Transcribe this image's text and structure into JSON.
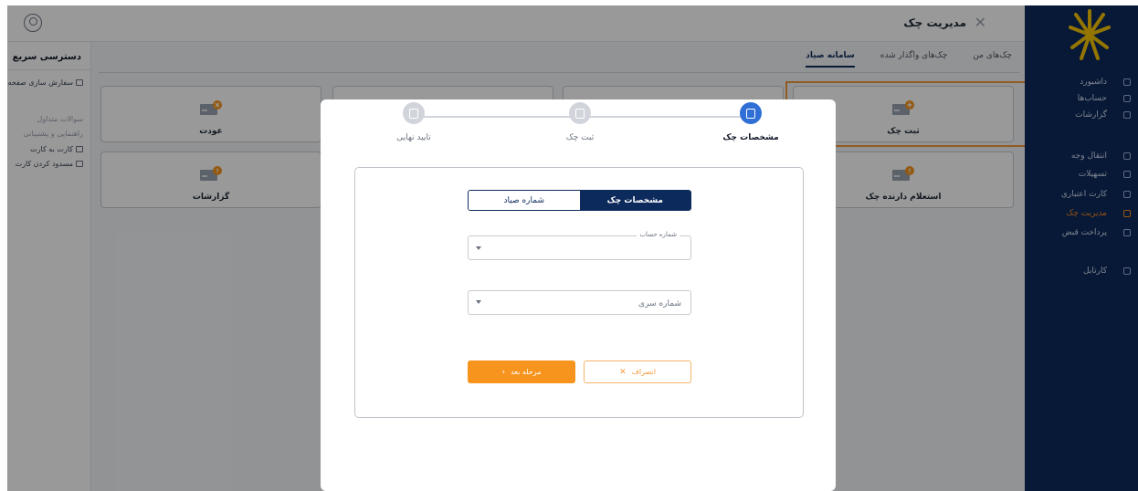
{
  "header": {
    "title": "مدیریت چک",
    "close_icon": "close-icon",
    "user_icon": "user-icon"
  },
  "quick_access": {
    "title": "دسترسی سریع",
    "items": [
      {
        "label": "سفارش سازی صفحه",
        "icon": "settings-icon",
        "muted": false
      },
      {
        "label": "سوالات متداول",
        "muted": true
      },
      {
        "label": "راهنمایی و پشتیبانی",
        "muted": true
      },
      {
        "label": "کارت به کارت",
        "icon": "card-icon",
        "muted": false
      },
      {
        "label": "مسدود کردن کارت",
        "icon": "block-card-icon",
        "muted": false
      }
    ]
  },
  "nav": {
    "items": [
      {
        "label": "داشبورد",
        "icon": "dashboard-icon"
      },
      {
        "label": "حساب‌ها",
        "icon": "accounts-icon"
      },
      {
        "label": "گزارشات",
        "icon": "reports-icon"
      },
      {
        "label": "انتقال وجه",
        "icon": "transfer-icon"
      },
      {
        "label": "تسهیلات",
        "icon": "loan-icon"
      },
      {
        "label": "کارت اعتباری",
        "icon": "credit-card-icon"
      },
      {
        "label": "مدیریت چک",
        "icon": "cheque-icon",
        "active": true
      },
      {
        "label": "پرداخت قبض",
        "icon": "bill-icon"
      },
      {
        "label": "کارتابل",
        "icon": "cartable-icon"
      }
    ],
    "active_color": "#ff8c1a"
  },
  "tabs": [
    {
      "label": "چک‌های من",
      "active": false
    },
    {
      "label": "چک‌های واگذار شده",
      "active": false
    },
    {
      "label": "سامانه صیاد",
      "active": true
    }
  ],
  "cards": {
    "register": "ثبت چک",
    "return": "عودت",
    "holder_inquiry": "استعلام دارنده چک",
    "reports": "گزارشات"
  },
  "modal": {
    "steps": [
      {
        "label": "مشخصات چک",
        "active": true
      },
      {
        "label": "ثبت چک",
        "active": false
      },
      {
        "label": "تایید نهایی",
        "active": false
      }
    ],
    "segment": {
      "active": "مشخصات چک",
      "inactive": "شماره صیاد"
    },
    "account_field": {
      "label": "شماره حساب",
      "value": ""
    },
    "serial_field": {
      "placeholder": "شماره سری",
      "value": ""
    },
    "buttons": {
      "next": "مرحله بعد",
      "cancel": "انصراف"
    }
  },
  "colors": {
    "primary": "#0d2a5c",
    "accent": "#f7941d",
    "step_active": "#2f6fd6",
    "highlight": "#f29a3b"
  }
}
